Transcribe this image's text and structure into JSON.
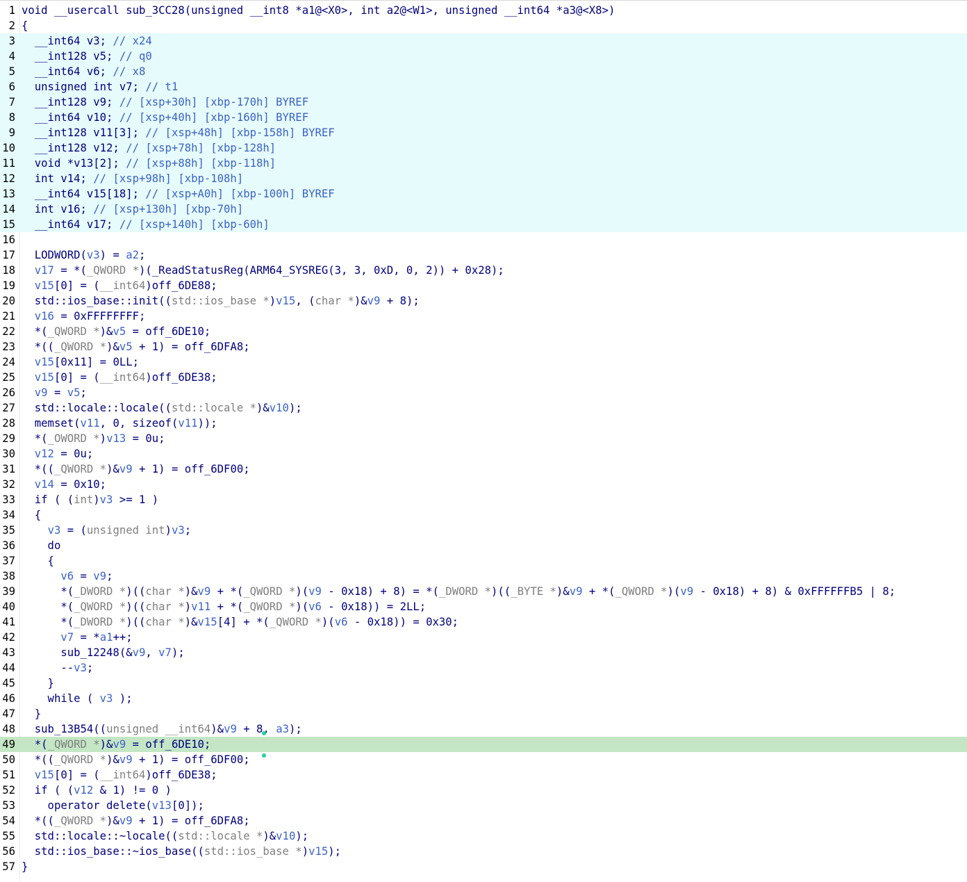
{
  "view": "pseudocode",
  "highlight_colors": {
    "declaration_block": "#e6fbfb",
    "current_line": "#c4e6c4",
    "keyword_text": "#000080",
    "variable_text": "#3b63c9",
    "type_text": "#7f7f7f"
  },
  "lines": [
    {
      "n": "1",
      "hl": "",
      "segs": [
        [
          "c",
          "void __usercall sub_3CC28(unsigned __int8 *a1@<X0>, int a2@<W1>, unsigned __int64 *a3@<X8>)"
        ]
      ]
    },
    {
      "n": "2",
      "hl": "",
      "segs": [
        [
          "c",
          "{"
        ]
      ]
    },
    {
      "n": "3",
      "hl": "decl",
      "segs": [
        [
          "c",
          "  __int64 v3; "
        ],
        [
          "v",
          "// x24"
        ]
      ]
    },
    {
      "n": "4",
      "hl": "decl",
      "segs": [
        [
          "c",
          "  __int128 v5; "
        ],
        [
          "v",
          "// q0"
        ]
      ]
    },
    {
      "n": "5",
      "hl": "decl",
      "segs": [
        [
          "c",
          "  __int64 v6; "
        ],
        [
          "v",
          "// x8"
        ]
      ]
    },
    {
      "n": "6",
      "hl": "decl",
      "segs": [
        [
          "c",
          "  unsigned int v7; "
        ],
        [
          "v",
          "// t1"
        ]
      ]
    },
    {
      "n": "7",
      "hl": "decl",
      "segs": [
        [
          "c",
          "  __int128 v9; "
        ],
        [
          "v",
          "// [xsp+30h] [xbp-170h] BYREF"
        ]
      ]
    },
    {
      "n": "8",
      "hl": "decl",
      "segs": [
        [
          "c",
          "  __int64 v10; "
        ],
        [
          "v",
          "// [xsp+40h] [xbp-160h] BYREF"
        ]
      ]
    },
    {
      "n": "9",
      "hl": "decl",
      "segs": [
        [
          "c",
          "  __int128 v11[3]; "
        ],
        [
          "v",
          "// [xsp+48h] [xbp-158h] BYREF"
        ]
      ]
    },
    {
      "n": "10",
      "hl": "decl",
      "segs": [
        [
          "c",
          "  __int128 v12; "
        ],
        [
          "v",
          "// [xsp+78h] [xbp-128h]"
        ]
      ]
    },
    {
      "n": "11",
      "hl": "decl",
      "segs": [
        [
          "c",
          "  void *v13[2]; "
        ],
        [
          "v",
          "// [xsp+88h] [xbp-118h]"
        ]
      ]
    },
    {
      "n": "12",
      "hl": "decl",
      "segs": [
        [
          "c",
          "  int v14; "
        ],
        [
          "v",
          "// [xsp+98h] [xbp-108h]"
        ]
      ]
    },
    {
      "n": "13",
      "hl": "decl",
      "segs": [
        [
          "c",
          "  __int64 v15[18]; "
        ],
        [
          "v",
          "// [xsp+A0h] [xbp-100h] BYREF"
        ]
      ]
    },
    {
      "n": "14",
      "hl": "decl",
      "segs": [
        [
          "c",
          "  int v16; "
        ],
        [
          "v",
          "// [xsp+130h] [xbp-70h]"
        ]
      ]
    },
    {
      "n": "15",
      "hl": "decl",
      "segs": [
        [
          "c",
          "  __int64 v17; "
        ],
        [
          "v",
          "// [xsp+140h] [xbp-60h]"
        ]
      ]
    },
    {
      "n": "16",
      "hl": "",
      "segs": [
        [
          "c",
          ""
        ]
      ]
    },
    {
      "n": "17",
      "hl": "",
      "segs": [
        [
          "c",
          "  LODWORD("
        ],
        [
          "v",
          "v3"
        ],
        [
          "c",
          ") = "
        ],
        [
          "v",
          "a2"
        ],
        [
          "c",
          ";"
        ]
      ]
    },
    {
      "n": "18",
      "hl": "",
      "segs": [
        [
          "c",
          "  "
        ],
        [
          "v",
          "v17"
        ],
        [
          "c",
          " = *("
        ],
        [
          "g",
          "_QWORD *"
        ],
        [
          "c",
          ")(_ReadStatusReg(ARM64_SYSREG(3, 3, 0xD, 0, 2)) + 0x28);"
        ]
      ]
    },
    {
      "n": "19",
      "hl": "",
      "segs": [
        [
          "c",
          "  "
        ],
        [
          "v",
          "v15"
        ],
        [
          "c",
          "[0] = ("
        ],
        [
          "g",
          "__int64"
        ],
        [
          "c",
          ")off_6DE88;"
        ]
      ]
    },
    {
      "n": "20",
      "hl": "",
      "segs": [
        [
          "c",
          "  std::ios_base::init(("
        ],
        [
          "g",
          "std::ios_base *"
        ],
        [
          "c",
          ")"
        ],
        [
          "v",
          "v15"
        ],
        [
          "c",
          ", ("
        ],
        [
          "g",
          "char *"
        ],
        [
          "c",
          ")&"
        ],
        [
          "v",
          "v9"
        ],
        [
          "c",
          " + 8);"
        ]
      ]
    },
    {
      "n": "21",
      "hl": "",
      "segs": [
        [
          "c",
          "  "
        ],
        [
          "v",
          "v16"
        ],
        [
          "c",
          " = 0xFFFFFFFF;"
        ]
      ]
    },
    {
      "n": "22",
      "hl": "",
      "segs": [
        [
          "c",
          "  *("
        ],
        [
          "g",
          "_QWORD *"
        ],
        [
          "c",
          ")&"
        ],
        [
          "v",
          "v5"
        ],
        [
          "c",
          " = off_6DE10;"
        ]
      ]
    },
    {
      "n": "23",
      "hl": "",
      "segs": [
        [
          "c",
          "  *(("
        ],
        [
          "g",
          "_QWORD *"
        ],
        [
          "c",
          ")&"
        ],
        [
          "v",
          "v5"
        ],
        [
          "c",
          " + 1) = off_6DFA8;"
        ]
      ]
    },
    {
      "n": "24",
      "hl": "",
      "segs": [
        [
          "c",
          "  "
        ],
        [
          "v",
          "v15"
        ],
        [
          "c",
          "[0x11] = 0LL;"
        ]
      ]
    },
    {
      "n": "25",
      "hl": "",
      "segs": [
        [
          "c",
          "  "
        ],
        [
          "v",
          "v15"
        ],
        [
          "c",
          "[0] = ("
        ],
        [
          "g",
          "__int64"
        ],
        [
          "c",
          ")off_6DE38;"
        ]
      ]
    },
    {
      "n": "26",
      "hl": "",
      "segs": [
        [
          "c",
          "  "
        ],
        [
          "v",
          "v9"
        ],
        [
          "c",
          " = "
        ],
        [
          "v",
          "v5"
        ],
        [
          "c",
          ";"
        ]
      ]
    },
    {
      "n": "27",
      "hl": "",
      "segs": [
        [
          "c",
          "  std::locale::locale(("
        ],
        [
          "g",
          "std::locale *"
        ],
        [
          "c",
          ")&"
        ],
        [
          "v",
          "v10"
        ],
        [
          "c",
          ");"
        ]
      ]
    },
    {
      "n": "28",
      "hl": "",
      "segs": [
        [
          "c",
          "  memset("
        ],
        [
          "v",
          "v11"
        ],
        [
          "c",
          ", 0, sizeof("
        ],
        [
          "v",
          "v11"
        ],
        [
          "c",
          "));"
        ]
      ]
    },
    {
      "n": "29",
      "hl": "",
      "segs": [
        [
          "c",
          "  *("
        ],
        [
          "g",
          "_OWORD *"
        ],
        [
          "c",
          ")"
        ],
        [
          "v",
          "v13"
        ],
        [
          "c",
          " = 0u;"
        ]
      ]
    },
    {
      "n": "30",
      "hl": "",
      "segs": [
        [
          "c",
          "  "
        ],
        [
          "v",
          "v12"
        ],
        [
          "c",
          " = 0u;"
        ]
      ]
    },
    {
      "n": "31",
      "hl": "",
      "segs": [
        [
          "c",
          "  *(("
        ],
        [
          "g",
          "_QWORD *"
        ],
        [
          "c",
          ")&"
        ],
        [
          "v",
          "v9"
        ],
        [
          "c",
          " + 1) = off_6DF00;"
        ]
      ]
    },
    {
      "n": "32",
      "hl": "",
      "segs": [
        [
          "c",
          "  "
        ],
        [
          "v",
          "v14"
        ],
        [
          "c",
          " = 0x10;"
        ]
      ]
    },
    {
      "n": "33",
      "hl": "",
      "segs": [
        [
          "c",
          "  if ( ("
        ],
        [
          "g",
          "int"
        ],
        [
          "c",
          ")"
        ],
        [
          "v",
          "v3"
        ],
        [
          "c",
          " >= 1 )"
        ]
      ]
    },
    {
      "n": "34",
      "hl": "",
      "segs": [
        [
          "c",
          "  {"
        ]
      ]
    },
    {
      "n": "35",
      "hl": "",
      "segs": [
        [
          "c",
          "    "
        ],
        [
          "v",
          "v3"
        ],
        [
          "c",
          " = ("
        ],
        [
          "g",
          "unsigned int"
        ],
        [
          "c",
          ")"
        ],
        [
          "v",
          "v3"
        ],
        [
          "c",
          ";"
        ]
      ]
    },
    {
      "n": "36",
      "hl": "",
      "segs": [
        [
          "c",
          "    do"
        ]
      ]
    },
    {
      "n": "37",
      "hl": "",
      "segs": [
        [
          "c",
          "    {"
        ]
      ]
    },
    {
      "n": "38",
      "hl": "",
      "segs": [
        [
          "c",
          "      "
        ],
        [
          "v",
          "v6"
        ],
        [
          "c",
          " = "
        ],
        [
          "v",
          "v9"
        ],
        [
          "c",
          ";"
        ]
      ]
    },
    {
      "n": "39",
      "hl": "",
      "segs": [
        [
          "c",
          "      *("
        ],
        [
          "g",
          "_DWORD *"
        ],
        [
          "c",
          ")(("
        ],
        [
          "g",
          "char *"
        ],
        [
          "c",
          ")&"
        ],
        [
          "v",
          "v9"
        ],
        [
          "c",
          " + *("
        ],
        [
          "g",
          "_QWORD *"
        ],
        [
          "c",
          ")("
        ],
        [
          "v",
          "v9"
        ],
        [
          "c",
          " - 0x18) + 8) = *("
        ],
        [
          "g",
          "_DWORD *"
        ],
        [
          "c",
          ")(("
        ],
        [
          "g",
          "_BYTE *"
        ],
        [
          "c",
          ")&"
        ],
        [
          "v",
          "v9"
        ],
        [
          "c",
          " + *("
        ],
        [
          "g",
          "_QWORD *"
        ],
        [
          "c",
          ")("
        ],
        [
          "v",
          "v9"
        ],
        [
          "c",
          " - 0x18) + 8) & 0xFFFFFFB5 | 8;"
        ]
      ]
    },
    {
      "n": "40",
      "hl": "",
      "segs": [
        [
          "c",
          "      *("
        ],
        [
          "g",
          "_QWORD *"
        ],
        [
          "c",
          ")(("
        ],
        [
          "g",
          "char *"
        ],
        [
          "c",
          ")"
        ],
        [
          "v",
          "v11"
        ],
        [
          "c",
          " + *("
        ],
        [
          "g",
          "_QWORD *"
        ],
        [
          "c",
          ")("
        ],
        [
          "v",
          "v6"
        ],
        [
          "c",
          " - 0x18)) = 2LL;"
        ]
      ]
    },
    {
      "n": "41",
      "hl": "",
      "segs": [
        [
          "c",
          "      *("
        ],
        [
          "g",
          "_DWORD *"
        ],
        [
          "c",
          ")(("
        ],
        [
          "g",
          "char *"
        ],
        [
          "c",
          ")&"
        ],
        [
          "v",
          "v15"
        ],
        [
          "c",
          "[4] + *("
        ],
        [
          "g",
          "_QWORD *"
        ],
        [
          "c",
          ")("
        ],
        [
          "v",
          "v6"
        ],
        [
          "c",
          " - 0x18)) = 0x30;"
        ]
      ]
    },
    {
      "n": "42",
      "hl": "",
      "segs": [
        [
          "c",
          "      "
        ],
        [
          "v",
          "v7"
        ],
        [
          "c",
          " = *"
        ],
        [
          "v",
          "a1"
        ],
        [
          "c",
          "++;"
        ]
      ]
    },
    {
      "n": "43",
      "hl": "",
      "segs": [
        [
          "c",
          "      sub_12248(&"
        ],
        [
          "v",
          "v9"
        ],
        [
          "c",
          ", "
        ],
        [
          "v",
          "v7"
        ],
        [
          "c",
          ");"
        ]
      ]
    },
    {
      "n": "44",
      "hl": "",
      "segs": [
        [
          "c",
          "      --"
        ],
        [
          "v",
          "v3"
        ],
        [
          "c",
          ";"
        ]
      ]
    },
    {
      "n": "45",
      "hl": "",
      "segs": [
        [
          "c",
          "    }"
        ]
      ]
    },
    {
      "n": "46",
      "hl": "",
      "segs": [
        [
          "c",
          "    while ( "
        ],
        [
          "v",
          "v3"
        ],
        [
          "c",
          " );"
        ]
      ]
    },
    {
      "n": "47",
      "hl": "",
      "segs": [
        [
          "c",
          "  }"
        ]
      ]
    },
    {
      "n": "48",
      "hl": "",
      "segs": [
        [
          "c",
          "  sub_13B54(("
        ],
        [
          "g",
          "unsigned __int64"
        ],
        [
          "c",
          ")&"
        ],
        [
          "v",
          "v9"
        ],
        [
          "c",
          " + 8, "
        ],
        [
          "v",
          "a3"
        ],
        [
          "c",
          ");"
        ]
      ]
    },
    {
      "n": "49",
      "hl": "cur",
      "segs": [
        [
          "c",
          "  *("
        ],
        [
          "g",
          "_QWORD *"
        ],
        [
          "c",
          ")&"
        ],
        [
          "v",
          "v9"
        ],
        [
          "c",
          " = off_6DE10;"
        ]
      ]
    },
    {
      "n": "50",
      "hl": "",
      "segs": [
        [
          "c",
          "  *(("
        ],
        [
          "g",
          "_QWORD *"
        ],
        [
          "c",
          ")&"
        ],
        [
          "v",
          "v9"
        ],
        [
          "c",
          " + 1) = off_6DF00;"
        ]
      ]
    },
    {
      "n": "51",
      "hl": "",
      "segs": [
        [
          "c",
          "  "
        ],
        [
          "v",
          "v15"
        ],
        [
          "c",
          "[0] = ("
        ],
        [
          "g",
          "__int64"
        ],
        [
          "c",
          ")off_6DE38;"
        ]
      ]
    },
    {
      "n": "52",
      "hl": "",
      "segs": [
        [
          "c",
          "  if ( ("
        ],
        [
          "v",
          "v12"
        ],
        [
          "c",
          " & 1) != 0 )"
        ]
      ]
    },
    {
      "n": "53",
      "hl": "",
      "segs": [
        [
          "c",
          "    operator delete("
        ],
        [
          "v",
          "v13"
        ],
        [
          "c",
          "[0]);"
        ]
      ]
    },
    {
      "n": "54",
      "hl": "",
      "segs": [
        [
          "c",
          "  *(("
        ],
        [
          "g",
          "_QWORD *"
        ],
        [
          "c",
          ")&"
        ],
        [
          "v",
          "v9"
        ],
        [
          "c",
          " + 1) = off_6DFA8;"
        ]
      ]
    },
    {
      "n": "55",
      "hl": "",
      "segs": [
        [
          "c",
          "  std::locale::~locale(("
        ],
        [
          "g",
          "std::locale *"
        ],
        [
          "c",
          ")&"
        ],
        [
          "v",
          "v10"
        ],
        [
          "c",
          ");"
        ]
      ]
    },
    {
      "n": "56",
      "hl": "",
      "segs": [
        [
          "c",
          "  std::ios_base::~ios_base(("
        ],
        [
          "g",
          "std::ios_base *"
        ],
        [
          "c",
          ")"
        ],
        [
          "v",
          "v15"
        ],
        [
          "c",
          ");"
        ]
      ]
    },
    {
      "n": "57",
      "hl": "",
      "segs": [
        [
          "c",
          "}"
        ]
      ]
    }
  ]
}
